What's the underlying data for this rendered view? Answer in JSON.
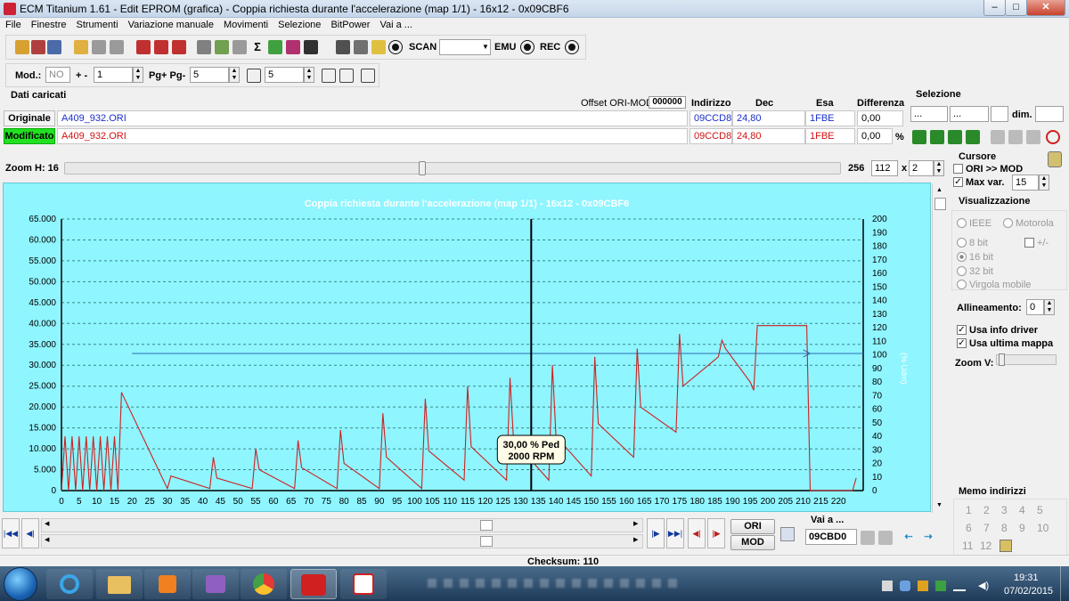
{
  "window": {
    "title": "ECM Titanium 1.61 - Edit EPROM (grafica) - Coppia richiesta durante l'accelerazione (map 1/1) - 16x12 - 0x09CBF6",
    "minimize": "–",
    "maximize": "□",
    "close": "✕"
  },
  "menu": [
    "File",
    "Finestre",
    "Strumenti",
    "Variazione manuale",
    "Movimenti",
    "Selezione",
    "BitPower",
    "Vai a ..."
  ],
  "toolbar": {
    "scan_label": "SCAN",
    "emu_label": "EMU",
    "rec_label": "REC",
    "scan_select": ""
  },
  "toolbar2": {
    "mod_label": "Mod.:",
    "mod_value": "NO",
    "plusminus_label": "+ -",
    "plusminus_value": "1",
    "pg_label": "Pg+ Pg-",
    "pg_value": "5",
    "step_value": "5"
  },
  "dati": {
    "title": "Dati caricati",
    "offset_label": "Offset ORI-MOD",
    "offset_value": "000000",
    "col_indirizzo": "Indirizzo",
    "col_dec": "Dec",
    "col_esa": "Esa",
    "col_diff": "Differenza",
    "originale_label": "Originale",
    "originale_file": "A409_932.ORI",
    "originale_addr": "09CCD8",
    "originale_dec": "24,80",
    "originale_esa": "1FBE",
    "originale_diff": "0,00",
    "modificato_label": "Modificato",
    "modificato_file": "A409_932.ORI",
    "modificato_addr": "09CCD8",
    "modificato_dec": "24,80",
    "modificato_esa": "1FBE",
    "modificato_diff": "0,00",
    "percent": "%"
  },
  "selezione": {
    "title": "Selezione",
    "field1": "...",
    "field2": "...",
    "dim_label": "dim."
  },
  "zoom": {
    "label": "Zoom H: 16",
    "max": "256",
    "value": "112",
    "x_label": "x",
    "mult": "2",
    "position": 0.46
  },
  "chart_data": {
    "type": "line",
    "title": "Coppia richiesta durante l'accelerazione (map 1/1) - 16x12 - 0x09CBF6",
    "y_left_ticks": [
      "65.000",
      "60.000",
      "55.000",
      "50.000",
      "45.000",
      "40.000",
      "35.000",
      "30.000",
      "25.000",
      "20.000",
      "15.000",
      "10.000",
      "5.000",
      "0"
    ],
    "y_right_ticks": [
      "200",
      "190",
      "180",
      "170",
      "160",
      "150",
      "140",
      "130",
      "120",
      "110",
      "100",
      "90",
      "80",
      "70",
      "60",
      "50",
      "40",
      "30",
      "20",
      "10",
      "0"
    ],
    "y_right_label": "(% Udm)",
    "x_ticks": [
      "0",
      "5",
      "10",
      "15",
      "20",
      "25",
      "30",
      "35",
      "40",
      "45",
      "50",
      "55",
      "60",
      "65",
      "70",
      "75",
      "80",
      "85",
      "90",
      "95",
      "100",
      "105",
      "110",
      "115",
      "120",
      "125",
      "130",
      "135",
      "140",
      "145",
      "150",
      "155",
      "160",
      "165",
      "170",
      "175",
      "180",
      "185",
      "190",
      "195",
      "200",
      "205",
      "210",
      "215",
      "220"
    ],
    "xlim": [
      0,
      227
    ],
    "ylim": [
      0,
      65000
    ],
    "cursor_x": 133,
    "cursor_label_1": "30,00 % Ped",
    "cursor_label_2": "2000 RPM",
    "reference_y": 101,
    "series": [
      {
        "color": "#cc2222",
        "x": [
          0,
          1,
          2,
          3,
          4,
          5,
          6,
          7,
          8,
          9,
          10,
          11,
          12,
          13,
          14,
          15,
          16,
          17,
          30,
          31,
          42,
          43,
          44,
          54,
          55,
          56,
          66,
          67,
          68,
          78,
          79,
          80,
          90,
          91,
          92,
          102,
          103,
          104,
          114,
          115,
          116,
          126,
          127,
          128,
          138,
          139,
          140,
          150,
          151,
          152,
          162,
          163,
          164,
          174,
          175,
          176,
          186,
          187,
          188,
          195,
          196,
          197,
          198,
          199,
          200,
          201,
          202,
          203,
          204,
          205,
          206,
          207,
          208,
          209,
          210,
          211,
          212,
          224,
          225
        ],
        "y": [
          0,
          13000,
          0,
          13000,
          0,
          13000,
          0,
          13000,
          0,
          13000,
          0,
          13000,
          0,
          13000,
          0,
          13000,
          0,
          23500,
          500,
          3500,
          500,
          8000,
          3000,
          500,
          10000,
          5000,
          500,
          12000,
          5500,
          500,
          14500,
          6500,
          500,
          18500,
          8000,
          500,
          22000,
          9500,
          2500,
          25000,
          10500,
          2500,
          27000,
          12000,
          2500,
          30000,
          13000,
          3500,
          32000,
          16000,
          8000,
          34000,
          20000,
          14000,
          37500,
          25000,
          32000,
          36000,
          34000,
          26000,
          24000,
          39500,
          39500,
          39500,
          39500,
          39500,
          39500,
          39500,
          39500,
          39500,
          39500,
          39500,
          39500,
          39500,
          39500,
          39500,
          0,
          0,
          3000
        ]
      }
    ]
  },
  "right_panel": {
    "cursore_title": "Cursore",
    "ori_mod_label": "ORI >> MOD",
    "max_var_label": "Max var.",
    "max_var_value": "15",
    "viz_title": "Visualizzazione",
    "ieee": "IEEE",
    "motorola": "Motorola",
    "bit8": "8 bit",
    "plusminus": "+/-",
    "bit16": "16 bit",
    "bit32": "32 bit",
    "virgola": "Virgola mobile",
    "allineamento_label": "Allineamento:",
    "allineamento_value": "0",
    "usa_info_driver": "Usa info driver",
    "usa_ultima_mappa": "Usa ultima mappa",
    "zoom_v_label": "Zoom V:",
    "memo_title": "Memo indirizzi",
    "memo": [
      "1",
      "2",
      "3",
      "4",
      "5",
      "6",
      "7",
      "8",
      "9",
      "10",
      "11",
      "12"
    ]
  },
  "bottom": {
    "ori_label": "ORI",
    "mod_label": "MOD",
    "vai_a_label": "Vai a ...",
    "vai_a_value": "09CBD0",
    "checksum": "Checksum: 110"
  },
  "taskbar": {
    "time": "19:31",
    "date": "07/02/2015"
  }
}
